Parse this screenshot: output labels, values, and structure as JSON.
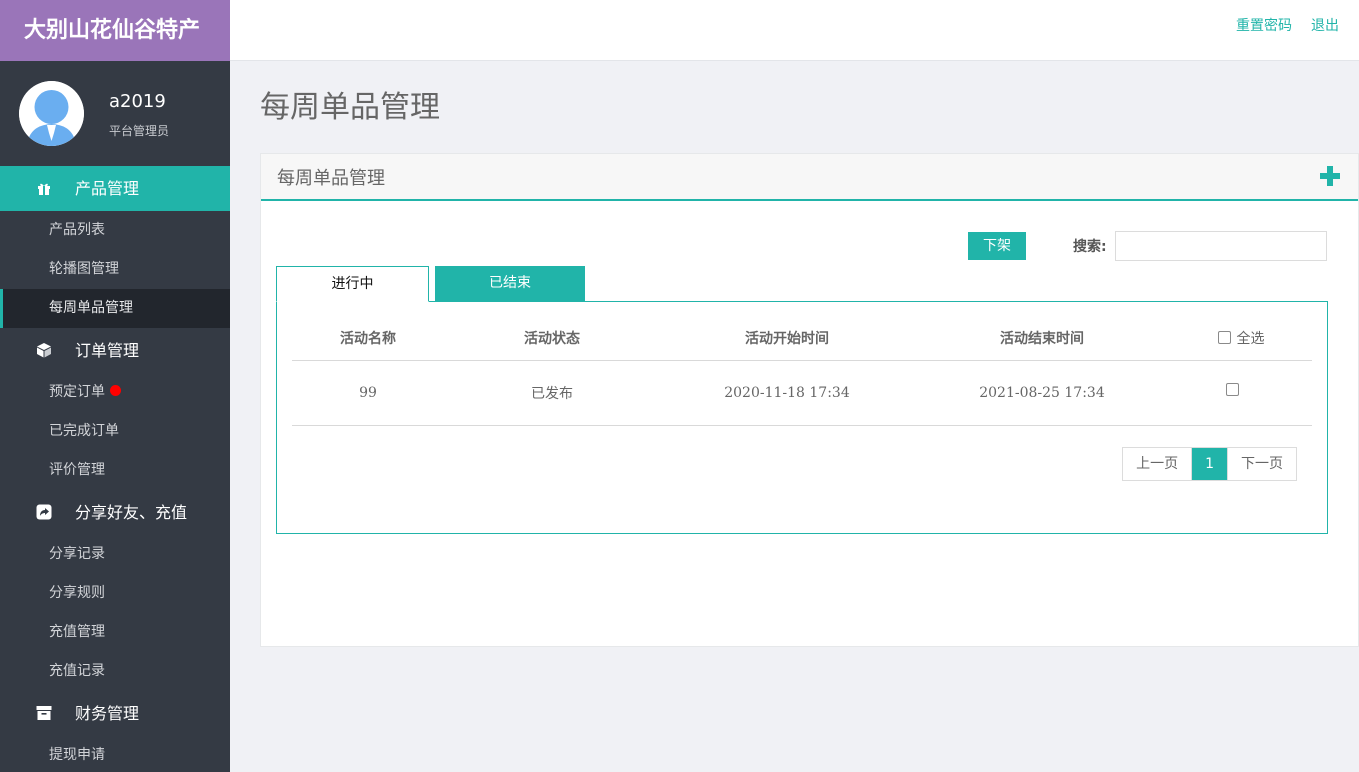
{
  "brand": "大别山花仙谷特产",
  "profile": {
    "name": "a2019",
    "role": "平台管理员"
  },
  "sidebar": {
    "groups": [
      {
        "label": "产品管理",
        "icon": "gift-icon",
        "items": [
          "产品列表",
          "轮播图管理",
          "每周单品管理"
        ]
      },
      {
        "label": "订单管理",
        "icon": "cube-icon",
        "items": [
          "预定订单",
          "已完成订单",
          "评价管理"
        ]
      },
      {
        "label": "分享好友、充值",
        "icon": "share-icon",
        "items": [
          "分享记录",
          "分享规则",
          "充值管理",
          "充值记录"
        ]
      },
      {
        "label": "财务管理",
        "icon": "archive-icon",
        "items": [
          "提现申请"
        ]
      }
    ],
    "active_item": "每周单品管理",
    "notification_item": "预定订单"
  },
  "topbar": {
    "reset_password": "重置密码",
    "logout": "退出"
  },
  "page": {
    "title": "每周单品管理"
  },
  "panel": {
    "title": "每周单品管理",
    "add_icon": "plus-icon",
    "offline_button": "下架",
    "search_label": "搜索:",
    "search_value": "",
    "tabs": [
      {
        "label": "进行中",
        "active": true
      },
      {
        "label": "已结束",
        "active": false
      }
    ],
    "table": {
      "headers": [
        "活动名称",
        "活动状态",
        "活动开始时间",
        "活动结束时间"
      ],
      "select_all_label": "全选",
      "rows": [
        {
          "name": "99",
          "status": "已发布",
          "start": "2020-11-18 17:34",
          "end": "2021-08-25 17:34"
        }
      ]
    },
    "pagination": {
      "prev": "上一页",
      "current": "1",
      "next": "下一页"
    }
  },
  "colors": {
    "accent": "#21b4a9",
    "brand_bg": "#9a75b9",
    "sidebar_bg": "#343a44",
    "notification": "#ff0000"
  }
}
